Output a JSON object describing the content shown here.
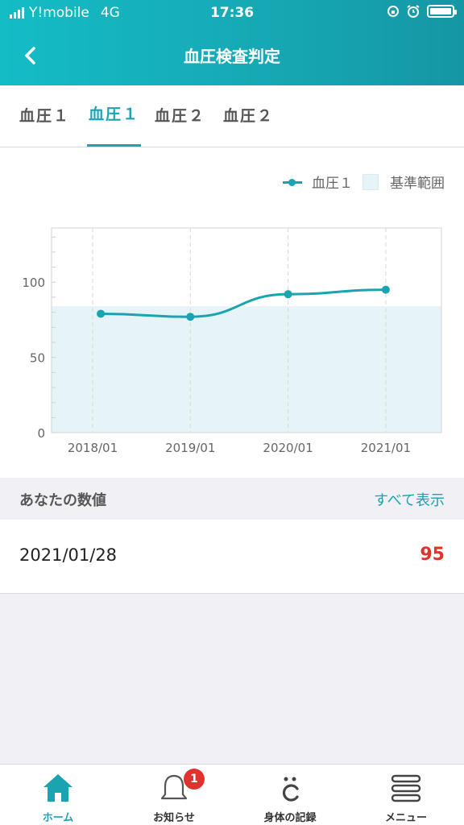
{
  "status_bar": {
    "carrier": "Y!mobile",
    "network": "4G",
    "time": "17:36"
  },
  "header": {
    "title": "血圧検査判定"
  },
  "tabs": [
    {
      "label": "血圧１",
      "active": false
    },
    {
      "label": "血圧１",
      "active": true
    },
    {
      "label": "血圧２",
      "active": false
    },
    {
      "label": "血圧２",
      "active": false
    }
  ],
  "legend": {
    "series_label": "血圧１",
    "range_label": "基準範囲"
  },
  "chart_data": {
    "type": "line",
    "x": [
      "2018/01",
      "2019/01",
      "2020/01",
      "2021/01"
    ],
    "series": [
      {
        "name": "血圧１",
        "points": [
          [
            "2018/02",
            79
          ],
          [
            "2019/01",
            77
          ],
          [
            "2020/01",
            92
          ],
          [
            "2021/01",
            95
          ]
        ]
      }
    ],
    "reference_range": {
      "label": "基準範囲",
      "min": 0,
      "max": 84
    },
    "yticks": [
      0,
      50,
      100
    ],
    "ylim": [
      0,
      136
    ],
    "grid": "vertical dashed at x ticks",
    "legend_position": "top-right",
    "colors": {
      "line": "#1aa3b0",
      "range": "#e6f4f7"
    }
  },
  "values_section": {
    "title": "あなたの数値",
    "show_all": "すべて表示"
  },
  "value_rows": [
    {
      "date": "2021/01/28",
      "value": "95"
    }
  ],
  "bottom_nav": {
    "items": [
      {
        "label": "ホーム",
        "icon": "home-icon",
        "active": true
      },
      {
        "label": "お知らせ",
        "icon": "bell-icon",
        "badge": "1"
      },
      {
        "label": "身体の記録",
        "icon": "body-record-icon"
      },
      {
        "label": "メニュー",
        "icon": "menu-icon"
      }
    ]
  },
  "colors": {
    "accent": "#1aa3b0",
    "alert": "#e0332d",
    "header_gradient_start": "#14bcc6",
    "header_gradient_end": "#1596a5"
  }
}
